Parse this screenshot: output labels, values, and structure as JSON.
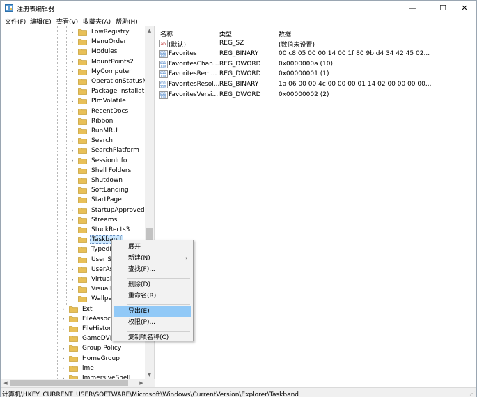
{
  "window": {
    "title": "注册表编辑器",
    "controls": {
      "minimize": "—",
      "maximize": "☐",
      "close": "✕"
    }
  },
  "menubar": {
    "items": [
      "文件(F)",
      "编辑(E)",
      "查看(V)",
      "收藏夹(A)",
      "帮助(H)"
    ]
  },
  "tree": {
    "items": [
      {
        "label": "LowRegistry",
        "level": 2,
        "expander": true
      },
      {
        "label": "MenuOrder",
        "level": 2,
        "expander": true
      },
      {
        "label": "Modules",
        "level": 2,
        "expander": true
      },
      {
        "label": "MountPoints2",
        "level": 2,
        "expander": true
      },
      {
        "label": "MyComputer",
        "level": 2,
        "expander": true
      },
      {
        "label": "OperationStatusMa",
        "level": 2,
        "expander": false
      },
      {
        "label": "Package Installation",
        "level": 2,
        "expander": false
      },
      {
        "label": "PlmVolatile",
        "level": 2,
        "expander": true
      },
      {
        "label": "RecentDocs",
        "level": 2,
        "expander": true
      },
      {
        "label": "Ribbon",
        "level": 2,
        "expander": false
      },
      {
        "label": "RunMRU",
        "level": 2,
        "expander": false
      },
      {
        "label": "Search",
        "level": 2,
        "expander": true
      },
      {
        "label": "SearchPlatform",
        "level": 2,
        "expander": true
      },
      {
        "label": "SessionInfo",
        "level": 2,
        "expander": true
      },
      {
        "label": "Shell Folders",
        "level": 2,
        "expander": false
      },
      {
        "label": "Shutdown",
        "level": 2,
        "expander": false
      },
      {
        "label": "SoftLanding",
        "level": 2,
        "expander": false
      },
      {
        "label": "StartPage",
        "level": 2,
        "expander": false
      },
      {
        "label": "StartupApproved",
        "level": 2,
        "expander": true
      },
      {
        "label": "Streams",
        "level": 2,
        "expander": true
      },
      {
        "label": "StuckRects3",
        "level": 2,
        "expander": false
      },
      {
        "label": "Taskband",
        "level": 2,
        "expander": false,
        "selected": true
      },
      {
        "label": "TypedPa",
        "level": 2,
        "expander": false
      },
      {
        "label": "User Sh",
        "level": 2,
        "expander": false
      },
      {
        "label": "UserAss",
        "level": 2,
        "expander": true
      },
      {
        "label": "VirtualD",
        "level": 2,
        "expander": true
      },
      {
        "label": "VisualEf",
        "level": 2,
        "expander": true
      },
      {
        "label": "Wallpap",
        "level": 2,
        "expander": false
      },
      {
        "label": "Ext",
        "level": 1,
        "expander": true
      },
      {
        "label": "FileAssociatio",
        "level": 1,
        "expander": true
      },
      {
        "label": "FileHistory",
        "level": 1,
        "expander": true
      },
      {
        "label": "GameDVR",
        "level": 1,
        "expander": false
      },
      {
        "label": "Group Policy",
        "level": 1,
        "expander": true
      },
      {
        "label": "HomeGroup",
        "level": 1,
        "expander": true
      },
      {
        "label": "ime",
        "level": 1,
        "expander": true
      },
      {
        "label": "ImmersiveShell",
        "level": 1,
        "expander": true
      }
    ]
  },
  "list": {
    "columns": [
      "名称",
      "类型",
      "数据"
    ],
    "rows": [
      {
        "icon": "string-value-icon",
        "name": "(默认)",
        "type": "REG_SZ",
        "data": "(数值未设置)"
      },
      {
        "icon": "binary-value-icon",
        "name": "Favorites",
        "type": "REG_BINARY",
        "data": "00 c8 05 00 00 14 00 1f 80 9b d4 34 42 45 02..."
      },
      {
        "icon": "binary-value-icon",
        "name": "FavoritesChan...",
        "type": "REG_DWORD",
        "data": "0x0000000a (10)"
      },
      {
        "icon": "binary-value-icon",
        "name": "FavoritesRem...",
        "type": "REG_DWORD",
        "data": "0x00000001 (1)"
      },
      {
        "icon": "binary-value-icon",
        "name": "FavoritesResol...",
        "type": "REG_BINARY",
        "data": "1a 06 00 00 4c 00 00 00 01 14 02 00 00 00 00..."
      },
      {
        "icon": "binary-value-icon",
        "name": "FavoritesVersi...",
        "type": "REG_DWORD",
        "data": "0x00000002 (2)"
      }
    ]
  },
  "context_menu": {
    "items": [
      {
        "label": "展开"
      },
      {
        "label": "新建(N)",
        "submenu": true
      },
      {
        "label": "查找(F)..."
      },
      {
        "separator": true
      },
      {
        "label": "删除(D)"
      },
      {
        "label": "重命名(R)"
      },
      {
        "separator": true
      },
      {
        "label": "导出(E)",
        "highlighted": true
      },
      {
        "label": "权限(P)..."
      },
      {
        "separator": true
      },
      {
        "label": "复制项名称(C)"
      }
    ],
    "submenu_arrow": "›"
  },
  "statusbar": {
    "path": "计算机\\HKEY_CURRENT_USER\\SOFTWARE\\Microsoft\\Windows\\CurrentVersion\\Explorer\\Taskband"
  },
  "colors": {
    "folder": "#e8c058",
    "selection": "#cce8ff",
    "menu_highlight": "#91c9f7",
    "binary_icon": "#2c6fc0",
    "string_icon": "#c03030"
  }
}
